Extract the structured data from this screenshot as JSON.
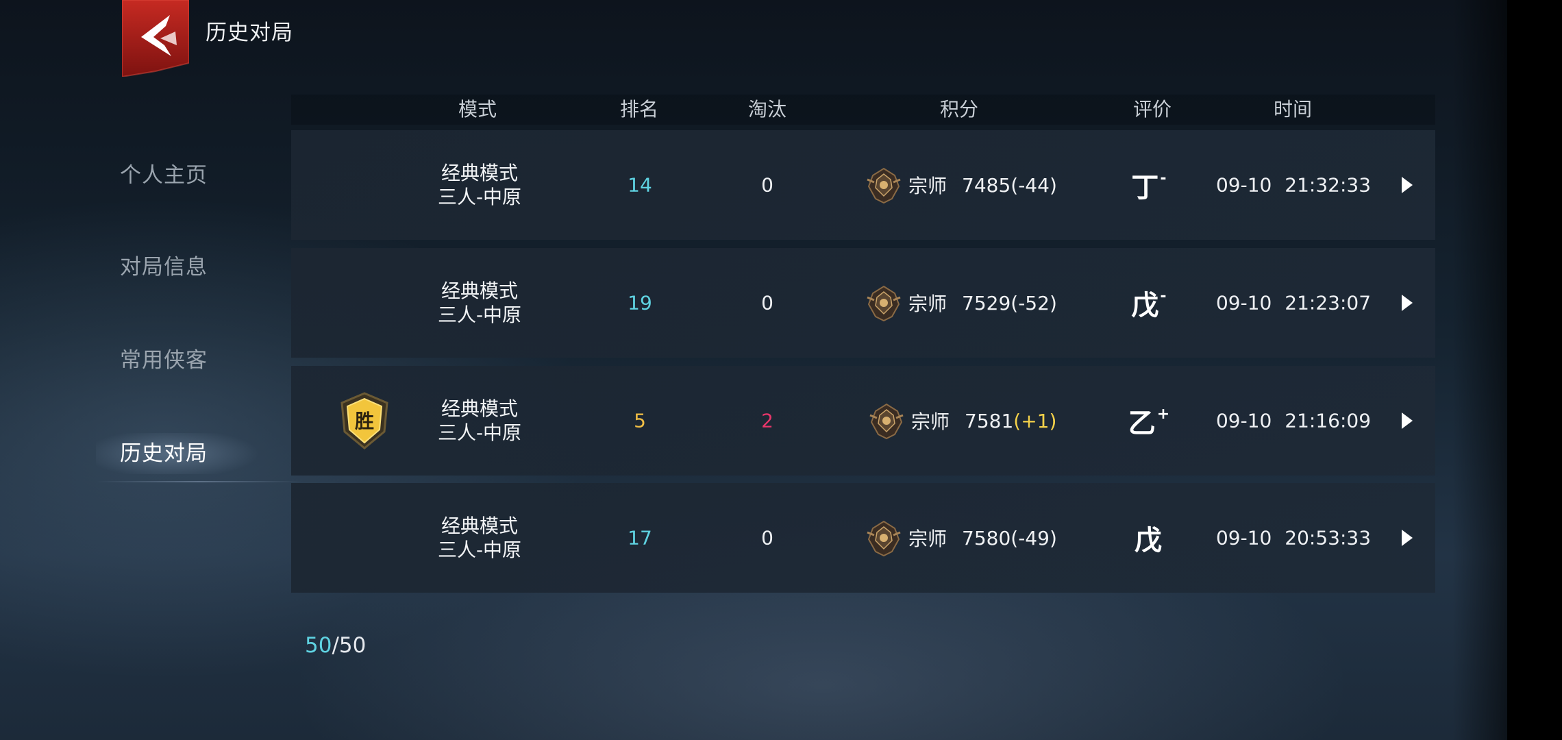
{
  "header": {
    "title": "历史对局",
    "back_icon": "back-arrow-icon"
  },
  "sidebar": {
    "items": [
      {
        "label": "个人主页",
        "active": false
      },
      {
        "label": "对局信息",
        "active": false
      },
      {
        "label": "常用侠客",
        "active": false
      },
      {
        "label": "历史对局",
        "active": true
      }
    ]
  },
  "table": {
    "headers": {
      "mode": "模式",
      "rank": "排名",
      "elim": "淘汰",
      "score": "积分",
      "grade": "评价",
      "time": "时间"
    },
    "rows": [
      {
        "mode_line1": "经典模式",
        "mode_line2": "三人-中原",
        "rank": "14",
        "elim": "0",
        "tier": "宗师",
        "score": "7485",
        "delta": "(-44)",
        "grade": "丁",
        "grade_mark": "-",
        "time": "09-10 21:32:33",
        "win": false
      },
      {
        "mode_line1": "经典模式",
        "mode_line2": "三人-中原",
        "rank": "19",
        "elim": "0",
        "tier": "宗师",
        "score": "7529",
        "delta": "(-52)",
        "grade": "戊",
        "grade_mark": "-",
        "time": "09-10 21:23:07",
        "win": false
      },
      {
        "mode_line1": "经典模式",
        "mode_line2": "三人-中原",
        "rank": "5",
        "elim": "2",
        "tier": "宗师",
        "score": "7581",
        "delta": "(+1)",
        "grade": "乙",
        "grade_mark": "+",
        "time": "09-10 21:16:09",
        "win": true,
        "win_label": "胜"
      },
      {
        "mode_line1": "经典模式",
        "mode_line2": "三人-中原",
        "rank": "17",
        "elim": "0",
        "tier": "宗师",
        "score": "7580",
        "delta": "(-49)",
        "grade": "戊",
        "grade_mark": "",
        "time": "09-10 20:53:33",
        "win": false
      }
    ]
  },
  "pager": {
    "current": "50",
    "total": "/50"
  },
  "colors": {
    "cyan": "#5fd3e2",
    "gold": "#f2bf45",
    "pink": "#e8366a",
    "accent_red": "#b8211c"
  }
}
